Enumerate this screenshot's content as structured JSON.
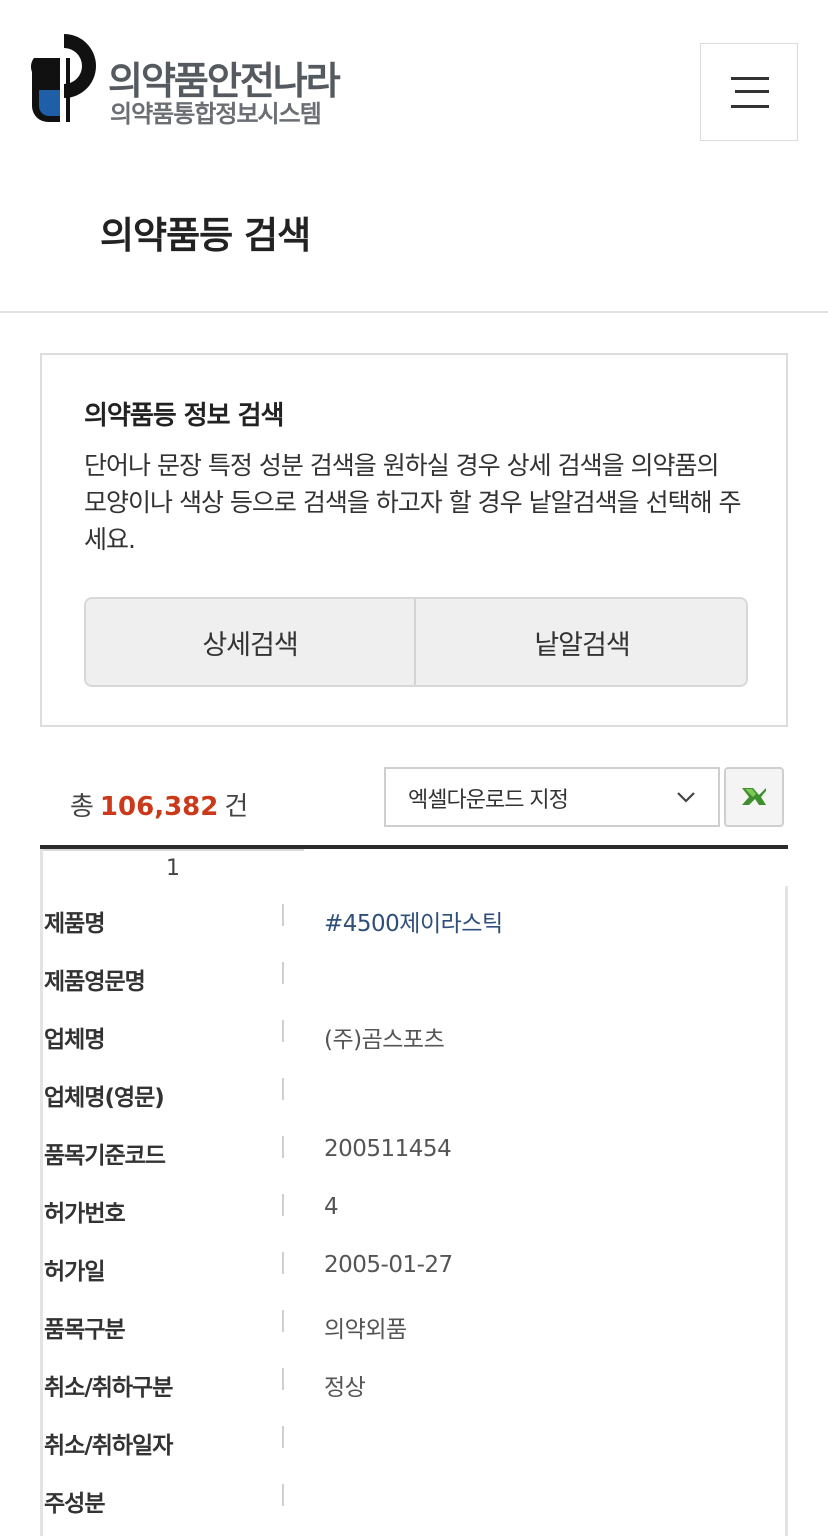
{
  "header": {
    "logo_title": "의약품안전나라",
    "logo_subtitle": "의약품통합정보시스템",
    "menu_icon": "hamburger-menu-icon"
  },
  "page": {
    "title": "의약품등 검색"
  },
  "info_box": {
    "title": "의약품등 정보 검색",
    "description": "단어나 문장 특정 성분 검색을 원하실 경우 상세 검색을 의약품의 모양이나 색상 등으로 검색을 하고자 할 경우 낱알검색을 선택해 주세요.",
    "buttons": {
      "detail": "상세검색",
      "pill": "낱알검색"
    }
  },
  "results": {
    "total_prefix": "총",
    "total_count": "106,382",
    "total_suffix": "건",
    "excel_select": "엑셀다운로드 지정",
    "excel_icon": "excel-icon",
    "row_number": "1"
  },
  "record": {
    "rows": [
      {
        "label": "제품명",
        "value": "#4500제이라스틱"
      },
      {
        "label": "제품영문명",
        "value": ""
      },
      {
        "label": "업체명",
        "value": "(주)곰스포츠"
      },
      {
        "label": "업체명(영문)",
        "value": ""
      },
      {
        "label": "품목기준코드",
        "value": "200511454"
      },
      {
        "label": "허가번호",
        "value": "4"
      },
      {
        "label": "허가일",
        "value": "2005-01-27"
      },
      {
        "label": "품목구분",
        "value": "의약외품"
      },
      {
        "label": "취소/취하구분",
        "value": "정상"
      },
      {
        "label": "취소/취하일자",
        "value": ""
      },
      {
        "label": "주성분",
        "value": ""
      }
    ]
  },
  "colors": {
    "accent_count": "#c9391a",
    "logo_blue": "#1f5fa8",
    "logo_dark": "#111111",
    "link": "#2f4f7a"
  }
}
